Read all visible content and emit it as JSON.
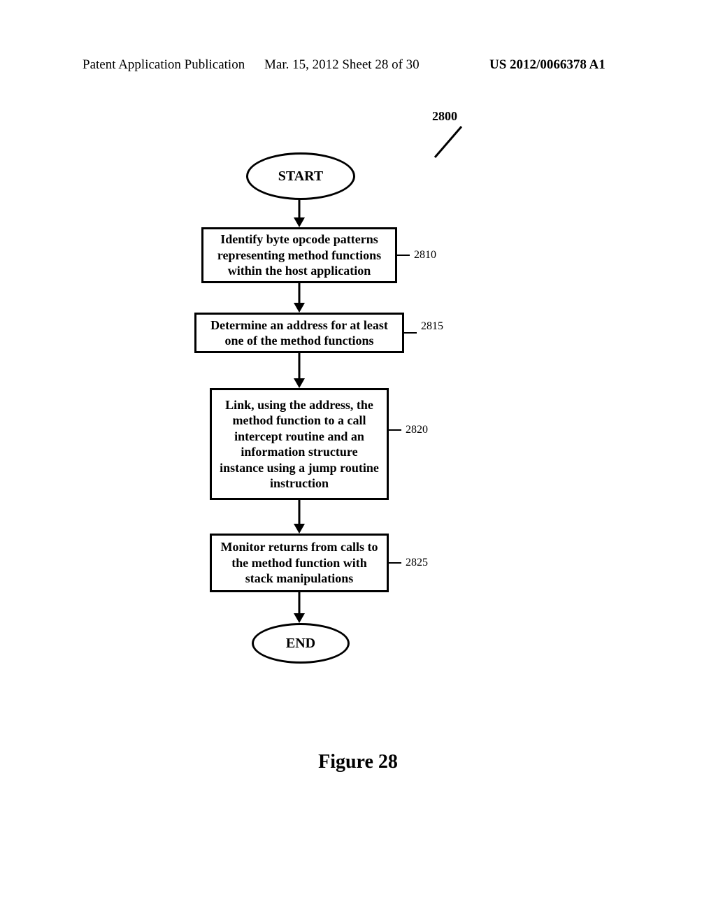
{
  "header": {
    "left": "Patent Application Publication",
    "middle": "Mar. 15, 2012  Sheet 28 of 30",
    "right": "US 2012/0066378 A1"
  },
  "figure": {
    "number_label": "2800",
    "start": "START",
    "end": "END",
    "caption": "Figure 28",
    "steps": [
      {
        "ref": "2810",
        "text": "Identify byte opcode patterns representing method functions within the host application"
      },
      {
        "ref": "2815",
        "text": "Determine an address for at least one of the method functions"
      },
      {
        "ref": "2820",
        "text": "Link, using the address, the method function to a call intercept routine and an information structure instance using a jump routine instruction"
      },
      {
        "ref": "2825",
        "text": "Monitor returns from calls to the method function with stack manipulations"
      }
    ]
  }
}
